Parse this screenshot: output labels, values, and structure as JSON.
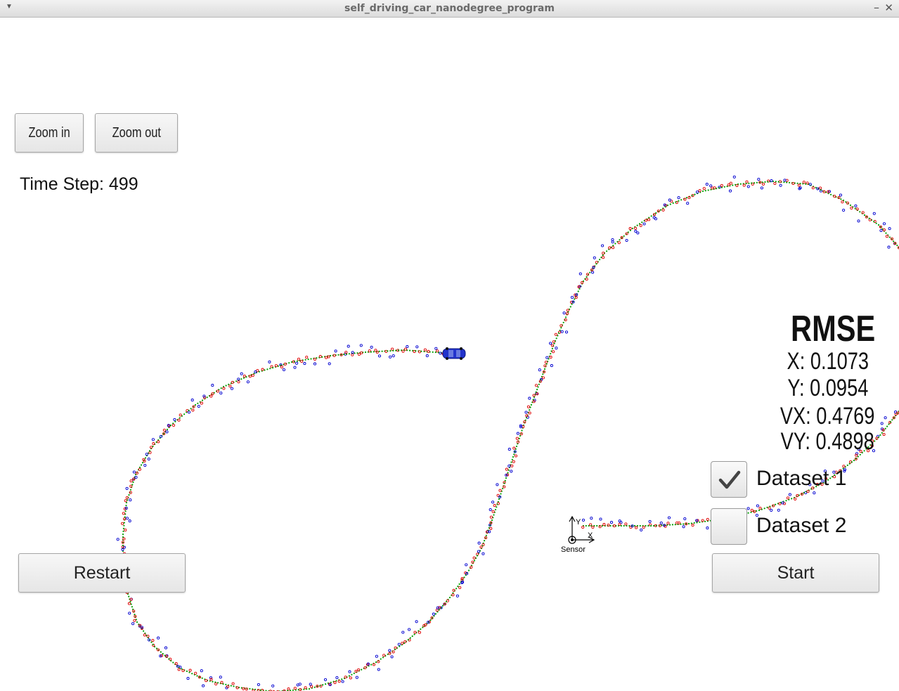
{
  "window": {
    "title": "self_driving_car_nanodegree_program",
    "menu_icon": "triangle-down-icon",
    "minimize_icon": "minus-icon",
    "close_icon": "x-icon"
  },
  "toolbar": {
    "zoom_in_label": "Zoom in",
    "zoom_out_label": "Zoom out"
  },
  "time_step": "Time Step: 499",
  "rmse": {
    "title": "RMSE",
    "x": "X: 0.1073",
    "y": "Y: 0.0954",
    "vx": "VX: 0.4769",
    "vy": "VY: 0.4898"
  },
  "datasets": [
    {
      "label": "Dataset 1",
      "checked": true
    },
    {
      "label": "Dataset 2",
      "checked": false
    }
  ],
  "controls": {
    "restart_label": "Restart",
    "start_label": "Start"
  },
  "sensor": {
    "label": "Sensor",
    "x_axis": "X",
    "y_axis": "Y"
  },
  "colors": {
    "ground_truth": "#00a000",
    "lidar": "#e00000",
    "radar": "#0000d0",
    "car": "#2233cc"
  }
}
